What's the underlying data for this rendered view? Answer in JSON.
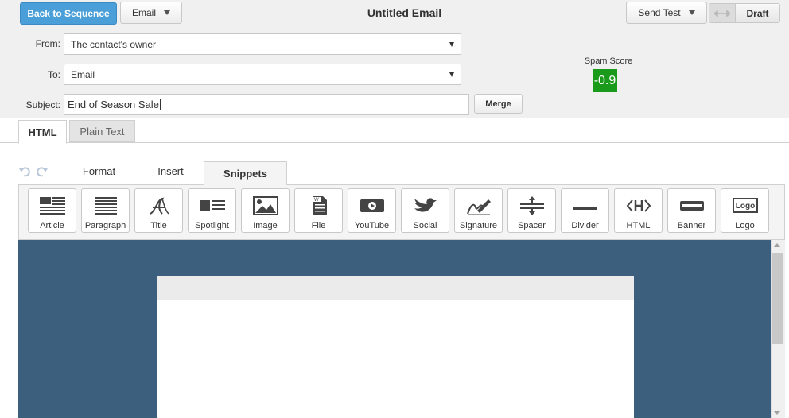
{
  "header": {
    "back_label": "Back to Sequence",
    "type_label": "Email",
    "title": "Untitled Email",
    "send_test_label": "Send Test",
    "status_label": "Draft"
  },
  "form": {
    "from_label": "From:",
    "from_value": "The contact's owner",
    "to_label": "To:",
    "to_value": "Email",
    "subject_label": "Subject:",
    "subject_value": "End of Season Sale",
    "merge_label": "Merge"
  },
  "spam": {
    "label": "Spam Score",
    "value": "-0.9",
    "color": "#1a9a1a"
  },
  "content_tabs": [
    {
      "label": "HTML",
      "active": true
    },
    {
      "label": "Plain Text",
      "active": false
    }
  ],
  "toolbar_tabs": [
    {
      "label": "Format"
    },
    {
      "label": "Insert"
    },
    {
      "label": "Snippets",
      "active": true
    }
  ],
  "snippets": [
    {
      "label": "Article",
      "icon": "article-icon"
    },
    {
      "label": "Paragraph",
      "icon": "paragraph-icon"
    },
    {
      "label": "Title",
      "icon": "title-icon"
    },
    {
      "label": "Spotlight",
      "icon": "spotlight-icon"
    },
    {
      "label": "Image",
      "icon": "image-icon"
    },
    {
      "label": "File",
      "icon": "file-icon"
    },
    {
      "label": "YouTube",
      "icon": "youtube-icon"
    },
    {
      "label": "Social",
      "icon": "social-icon"
    },
    {
      "label": "Signature",
      "icon": "signature-icon"
    },
    {
      "label": "Spacer",
      "icon": "spacer-icon"
    },
    {
      "label": "Divider",
      "icon": "divider-icon"
    },
    {
      "label": "HTML",
      "icon": "html-icon"
    },
    {
      "label": "Banner",
      "icon": "banner-icon"
    },
    {
      "label": "Logo",
      "icon": "logo-icon"
    }
  ],
  "logo_icon_text": "Logo",
  "colors": {
    "primary": "#4a9fd8",
    "canvas": "#3c5f7e"
  }
}
